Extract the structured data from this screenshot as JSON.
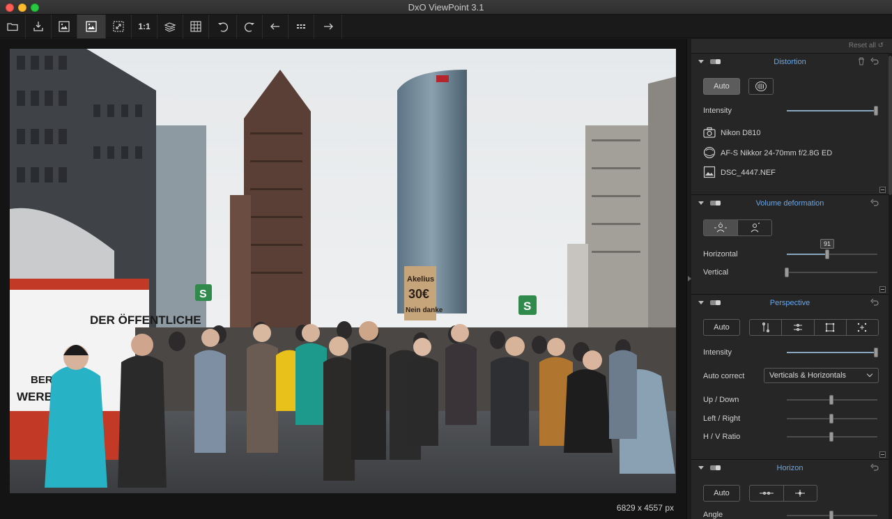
{
  "window": {
    "title": "DxO ViewPoint 3.1"
  },
  "toolbar": {
    "buttons": [
      {
        "icon": "folder-icon"
      },
      {
        "icon": "export-icon"
      },
      {
        "icon": "before-after-icon"
      },
      {
        "icon": "image-view-icon"
      },
      {
        "icon": "fit-to-screen-icon"
      },
      {
        "icon": "actual-size-icon",
        "label": "1:1"
      },
      {
        "icon": "compare-icon"
      },
      {
        "icon": "grid-icon"
      },
      {
        "icon": "rotate-left-icon"
      },
      {
        "icon": "rotate-right-icon"
      },
      {
        "icon": "previous-icon"
      },
      {
        "icon": "filmstrip-icon"
      },
      {
        "icon": "next-icon"
      }
    ]
  },
  "image": {
    "dimensions": "6829 x 4557 px",
    "signs": {
      "protest": "Akelius 30€ Nein danke",
      "banner": "DER ÖFFENTLICHE RAUM",
      "banner2": "BERLIN WERBEE",
      "station": "S"
    }
  },
  "panel": {
    "reset_all": "Reset all",
    "accent": "#69a7e8",
    "distortion": {
      "title": "Distortion",
      "auto_label": "Auto",
      "intensity_label": "Intensity",
      "intensity_value": 1.0,
      "camera": "Nikon D810",
      "lens": "AF-S Nikkor 24-70mm f/2.8G ED",
      "file": "DSC_4447.NEF"
    },
    "volume": {
      "title": "Volume deformation",
      "horizontal_label": "Horizontal",
      "horizontal_value": "91",
      "vertical_label": "Vertical"
    },
    "perspective": {
      "title": "Perspective",
      "auto_label": "Auto",
      "intensity_label": "Intensity",
      "auto_correct_label": "Auto correct",
      "auto_correct_value": "Verticals & Horizontals",
      "up_down_label": "Up / Down",
      "left_right_label": "Left / Right",
      "hv_ratio_label": "H / V Ratio"
    },
    "horizon": {
      "title": "Horizon",
      "auto_label": "Auto",
      "angle_label": "Angle"
    }
  }
}
